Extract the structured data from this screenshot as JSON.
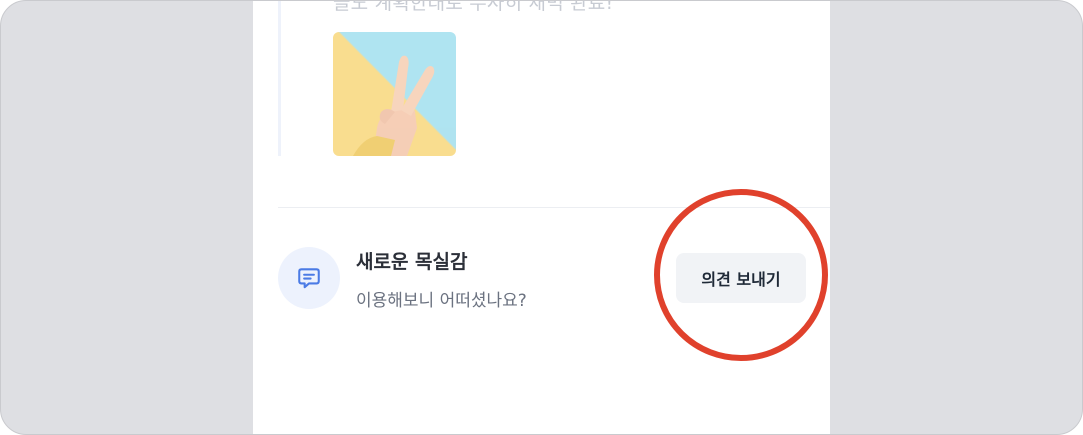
{
  "post": {
    "truncated_text": "늘도 계획한대로 무사히 새벽 완료!"
  },
  "feedback_card": {
    "title": "새로운 목실감",
    "subtitle": "이용해보니 어떠셨나요?",
    "button_label": "의견 보내기",
    "icon": "chat-bubble-icon"
  },
  "annotation": {
    "type": "circle-highlight",
    "target": "feedback-button",
    "color": "#e0412c"
  },
  "colors": {
    "background": "#dedfe3",
    "panel": "#ffffff",
    "accent": "#4b7be5",
    "button_bg": "#f1f3f6",
    "icon_bg": "#edf2fd"
  }
}
